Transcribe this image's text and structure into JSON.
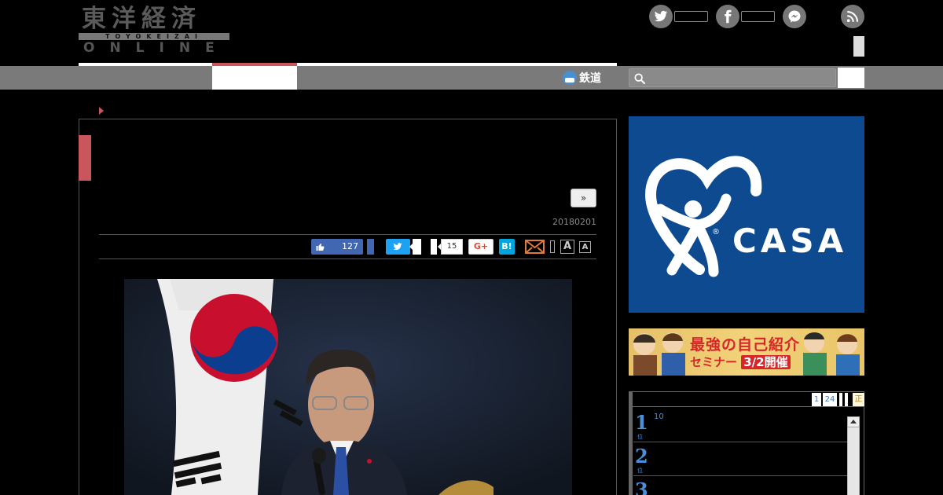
{
  "logo": {
    "jp": "東洋経済",
    "romaji": "TOYOKEIZAI",
    "en": "ONLINE"
  },
  "social": {
    "icons": [
      "twitter-icon",
      "facebook-icon",
      "messenger-icon",
      "rss-icon"
    ]
  },
  "nav": {
    "rail_label": "鉄道",
    "rail_icon": "train-icon",
    "search_icon": "search-icon"
  },
  "article": {
    "next_label": "»",
    "date": "20180201",
    "share": {
      "like_count": "127",
      "share_count": "15",
      "gplus_label": "G+",
      "hatena_label": "B!",
      "font_large": "A",
      "font_small": "A"
    }
  },
  "ads": {
    "casa_text": "CASA",
    "casa_reg": "®",
    "seminar_title": "最強の自己紹介",
    "seminar_sub": "セミナー",
    "seminar_date": "3/2開催"
  },
  "ranking": {
    "tabs": [
      "1",
      "24"
    ],
    "extra_tab": "正",
    "rows": [
      {
        "rank": "1",
        "unit": "位",
        "meta": "10"
      },
      {
        "rank": "2",
        "unit": "位",
        "meta": ""
      },
      {
        "rank": "3",
        "unit": "位",
        "meta": ""
      }
    ]
  },
  "colors": {
    "accent": "#c9565c",
    "nav_gray": "#7a7a7a",
    "facebook": "#4267b2",
    "twitter": "#1da1f2",
    "hatena": "#00a4de",
    "casa_blue": "#0d4a8f",
    "ranking_blue": "#4a90d9"
  }
}
